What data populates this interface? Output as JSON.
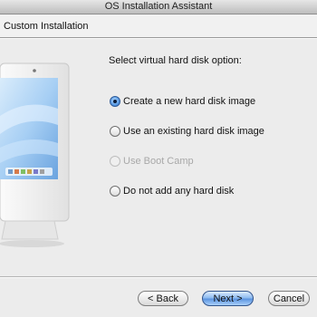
{
  "window": {
    "title": "OS Installation Assistant"
  },
  "header": {
    "title": "Custom Installation"
  },
  "prompt": "Select virtual hard disk option:",
  "options": [
    {
      "label": "Create a new hard disk image",
      "selected": true,
      "enabled": true
    },
    {
      "label": "Use an existing hard disk image",
      "selected": false,
      "enabled": true
    },
    {
      "label": "Use Boot Camp",
      "selected": false,
      "enabled": false
    },
    {
      "label": "Do not add any hard disk",
      "selected": false,
      "enabled": true
    }
  ],
  "buttons": {
    "back": "< Back",
    "next": "Next >",
    "cancel": "Cancel"
  },
  "colors": {
    "accent": "#5d95e0",
    "disabled_text": "#a8a8a8"
  }
}
